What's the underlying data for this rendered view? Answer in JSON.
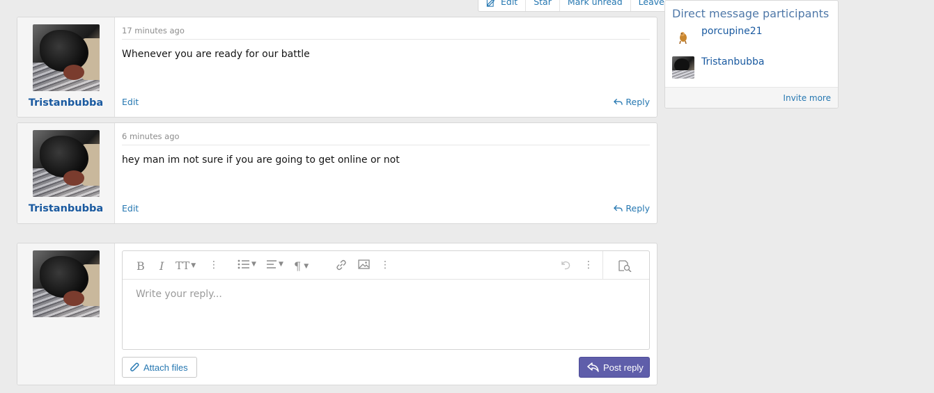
{
  "topbar": {
    "edit": "Edit",
    "star": "Star",
    "mark_unread": "Mark unread",
    "leave": "Leave"
  },
  "messages": [
    {
      "time": "17 minutes ago",
      "user": "Tristanbubba",
      "body": "Whenever you are ready for our battle",
      "edit": "Edit",
      "reply": "Reply"
    },
    {
      "time": "6 minutes ago",
      "user": "Tristanbubba",
      "body": "hey man im not sure if you are going to get online or not",
      "edit": "Edit",
      "reply": "Reply"
    }
  ],
  "sidebar": {
    "title": "Direct message participants",
    "participants": [
      "porcupine21",
      "Tristanbubba"
    ],
    "invite": "Invite more"
  },
  "reply_box": {
    "placeholder": "Write your reply...",
    "attach": "Attach files",
    "post": "Post reply"
  },
  "colors": {
    "link": "#2577b1",
    "username": "#1a5aa0",
    "primary_button": "#5f5eaa"
  }
}
